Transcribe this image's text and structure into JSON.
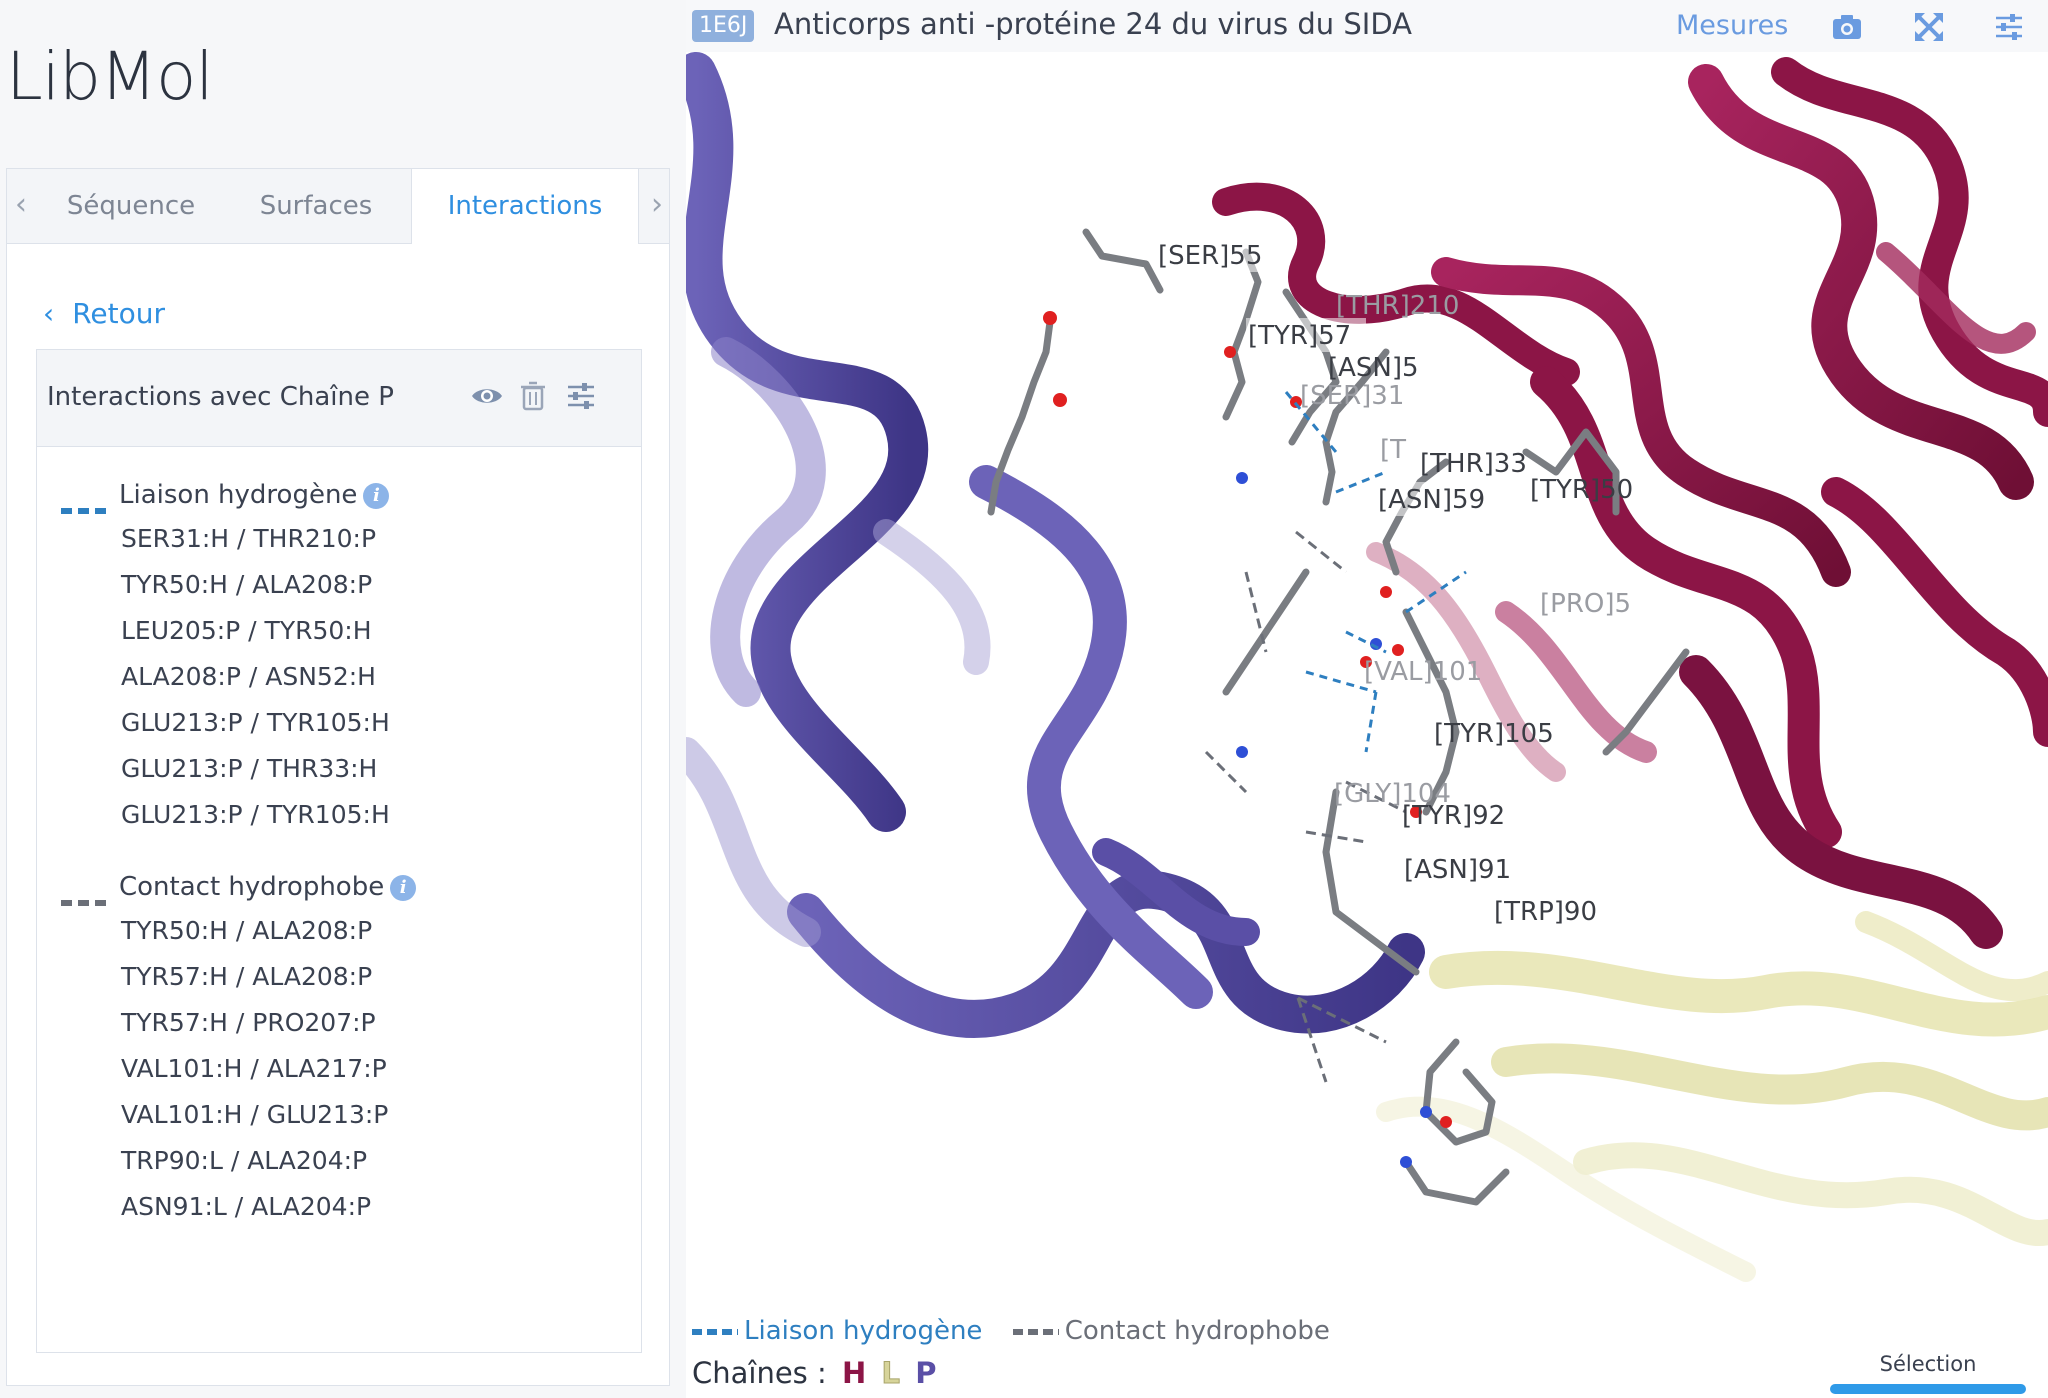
{
  "app": {
    "title": "LibMol"
  },
  "tabs": [
    {
      "label": "Séquence"
    },
    {
      "label": "Surfaces"
    },
    {
      "label": "Interactions"
    }
  ],
  "back": {
    "label": "Retour"
  },
  "interactions": {
    "header": "Interactions avec Chaîne P",
    "hbond": {
      "title": "Liaison hydrogène",
      "color": "#2e7fc0",
      "pairs": [
        "SER31:H / THR210:P",
        "TYR50:H / ALA208:P",
        "LEU205:P / TYR50:H",
        "ALA208:P / ASN52:H",
        "GLU213:P / TYR105:H",
        "GLU213:P / THR33:H",
        "GLU213:P / TYR105:H"
      ]
    },
    "hydrophobic": {
      "title": "Contact hydrophobe",
      "color": "#6b6f78",
      "pairs": [
        "TYR50:H / ALA208:P",
        "TYR57:H / ALA208:P",
        "TYR57:H / PRO207:P",
        "VAL101:H / ALA217:P",
        "VAL101:H / GLU213:P",
        "TRP90:L / ALA204:P",
        "ASN91:L / ALA204:P"
      ]
    }
  },
  "viewer": {
    "pdb_id": "1E6J",
    "title": "Anticorps anti -protéine 24 du virus du SIDA",
    "mesures_label": "Mesures",
    "icons": [
      "camera-icon",
      "fullscreen-icon",
      "settings-sliders-icon"
    ],
    "residue_labels": [
      "[SER]55",
      "[THR]210",
      "[TYR]57",
      "[ASN]5",
      "[SER]31",
      "[T",
      "[THR]33",
      "[TYR]50",
      "[ASN]59",
      "[PRO]5",
      "[VAL]101",
      "[TYR]105",
      "[GLY]104",
      "[TYR]92",
      "[ASN]91",
      "[TRP]90"
    ],
    "colors": {
      "chain_H": "#8c1546",
      "chain_L": "#e8e6b4",
      "chain_P": "#5a4fa6",
      "hbond": "#2e7fc0",
      "hydrophobic": "#6b6f78"
    }
  },
  "legend": {
    "hbond": "Liaison hydrogène",
    "hydrophobic": "Contact hydrophobe"
  },
  "chains": {
    "label": "Chaînes :",
    "items": [
      {
        "letter": "H",
        "color": "#8c1546"
      },
      {
        "letter": "L",
        "color": "#d7d49a"
      },
      {
        "letter": "P",
        "color": "#5a4fa6"
      }
    ]
  },
  "selection": {
    "label": "Sélection"
  }
}
